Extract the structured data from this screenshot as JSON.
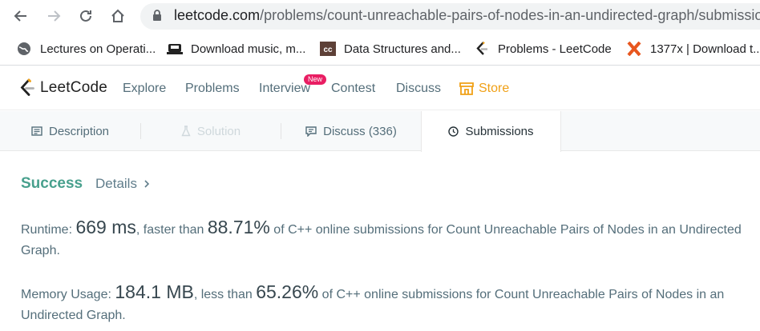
{
  "browser": {
    "url_host": "leetcode.com",
    "url_path": "/problems/count-unreachable-pairs-of-nodes-in-an-undirected-graph/submissio",
    "bookmarks": [
      {
        "label": "Lectures on Operati...",
        "icon": "globe-icon"
      },
      {
        "label": "Download music, m...",
        "icon": "car-icon"
      },
      {
        "label": "Data Structures and...",
        "icon": "cc-icon"
      },
      {
        "label": "Problems - LeetCode",
        "icon": "leetcode-icon"
      },
      {
        "label": "1377x | Download t...",
        "icon": "x-icon"
      }
    ]
  },
  "nav": {
    "brand": "LeetCode",
    "explore": "Explore",
    "problems": "Problems",
    "interview": "Interview",
    "new_badge": "New",
    "contest": "Contest",
    "discuss": "Discuss",
    "store": "Store",
    "colors": {
      "store": "#f0a016",
      "badge": "#e91e63"
    }
  },
  "tabs": {
    "description": "Description",
    "solution": "Solution",
    "discuss": "Discuss (336)",
    "submissions": "Submissions"
  },
  "result": {
    "status": "Success",
    "details": "Details",
    "runtime_label": "Runtime: ",
    "runtime_value": "669 ms",
    "runtime_mid": ", faster than ",
    "runtime_pct": "88.71%",
    "runtime_tail": " of C++ online submissions for Count Unreachable Pairs of Nodes in an Undirected Graph.",
    "memory_label": "Memory Usage: ",
    "memory_value": "184.1 MB",
    "memory_mid": ", less than ",
    "memory_pct": "65.26%",
    "memory_tail": " of C++ online submissions for Count Unreachable Pairs of Nodes in an Undirected Graph.",
    "colors": {
      "success": "#48a08d"
    }
  }
}
